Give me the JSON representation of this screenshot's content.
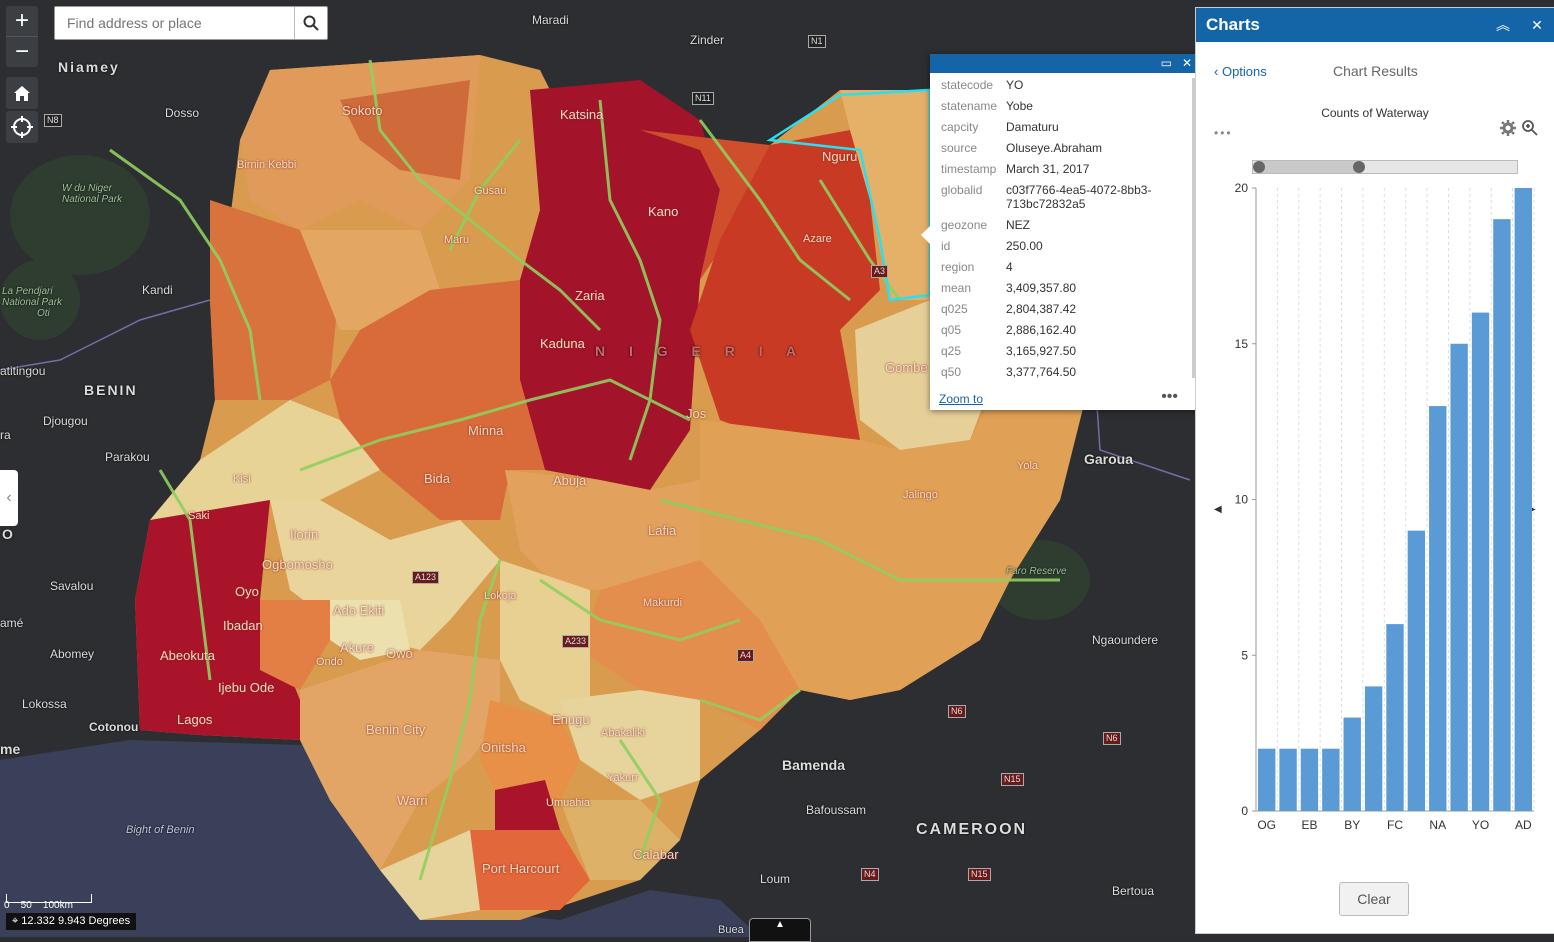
{
  "search": {
    "placeholder": "Find address or place"
  },
  "map_tools": {
    "zoom_in": "+",
    "zoom_out": "−"
  },
  "map": {
    "places": [
      "Niamey",
      "Dosso",
      "Maradi",
      "Zinder",
      "Kandi",
      "BENIN",
      "Djougou",
      "Parakou",
      "Savalou",
      "Abomey",
      "Lokossa",
      "Cotonou",
      "Garoua",
      "Ngaoundere",
      "Bamenda",
      "Bafoussam",
      "CAMEROON",
      "Loum",
      "Bertoua",
      "Buea",
      "atitingou",
      "ra",
      "amé",
      "me",
      "O",
      "Nguru",
      "Gombe",
      "Jos",
      "Lafia",
      "Abuja",
      "Minna",
      "Bida",
      "Ilorin",
      "Ogbomosho",
      "Oyo",
      "Ibadan",
      "Abeokuta",
      "Ijebu Ode",
      "Lagos",
      "Ado Ekiti",
      "Akure",
      "Owo",
      "Ondo",
      "Lokoja",
      "Makurdi",
      "Jalingo",
      "Enugu",
      "Abakaliki",
      "Onitsha",
      "Benin City",
      "Warri",
      "Umuahia",
      "Port Harcourt",
      "Calabar",
      "Yakurr",
      "Zaria",
      "Kaduna",
      "Kano",
      "Katsina",
      "Sokoto",
      "Birnin Kebbi",
      "Gusau",
      "Maru",
      "Azare",
      "Yola",
      "Saki",
      "Kisi",
      "N I G E R I A"
    ],
    "parks": [
      "W du Niger National Park",
      "La Pendjari National Park",
      "Faro Reserve",
      "Oti"
    ],
    "water": [
      "Bight of Benin"
    ],
    "shields": [
      "N8",
      "N1",
      "N11",
      "A123",
      "A233",
      "A4",
      "A3",
      "N6",
      "N15",
      "N4"
    ]
  },
  "popup": {
    "fields": [
      {
        "key": "statecode",
        "value": "YO"
      },
      {
        "key": "statename",
        "value": "Yobe"
      },
      {
        "key": "capcity",
        "value": "Damaturu"
      },
      {
        "key": "source",
        "value": "Oluseye.Abraham"
      },
      {
        "key": "timestamp",
        "value": "March 31, 2017"
      },
      {
        "key": "globalid",
        "value": "c03f7766-4ea5-4072-8bb3-713bc72832a5"
      },
      {
        "key": "geozone",
        "value": "NEZ"
      },
      {
        "key": "id",
        "value": "250.00"
      },
      {
        "key": "region",
        "value": "4"
      },
      {
        "key": "mean",
        "value": "3,409,357.80"
      },
      {
        "key": "q025",
        "value": "2,804,387.42"
      },
      {
        "key": "q05",
        "value": "2,886,162.40"
      },
      {
        "key": "q25",
        "value": "3,165,927.50"
      },
      {
        "key": "q50",
        "value": "3,377,764.50"
      }
    ],
    "zoom_to": "Zoom to",
    "more": "•••"
  },
  "panel": {
    "title": "Charts",
    "options_label": "Options",
    "results_title": "Chart Results",
    "clear_label": "Clear"
  },
  "scale": {
    "labels": "0    50    100km",
    "coords": "12.332 9.943 Degrees"
  },
  "attribution_tab": "",
  "colors": {
    "accent": "#1464a8",
    "bar": "#5b9bd5"
  },
  "chart_data": {
    "type": "bar",
    "title": "Counts of Waterway",
    "xlabel": "",
    "ylabel": "",
    "ylim": [
      0,
      20
    ],
    "yticks": [
      0,
      5,
      10,
      15,
      20
    ],
    "categories": [
      "OG",
      "",
      "EB",
      "",
      "BY",
      "",
      "FC",
      "",
      "NA",
      "",
      "YO",
      "",
      "AD"
    ],
    "values": [
      2,
      2,
      2,
      2,
      3,
      4,
      6,
      9,
      13,
      15,
      16,
      19,
      20
    ],
    "grid": true
  }
}
